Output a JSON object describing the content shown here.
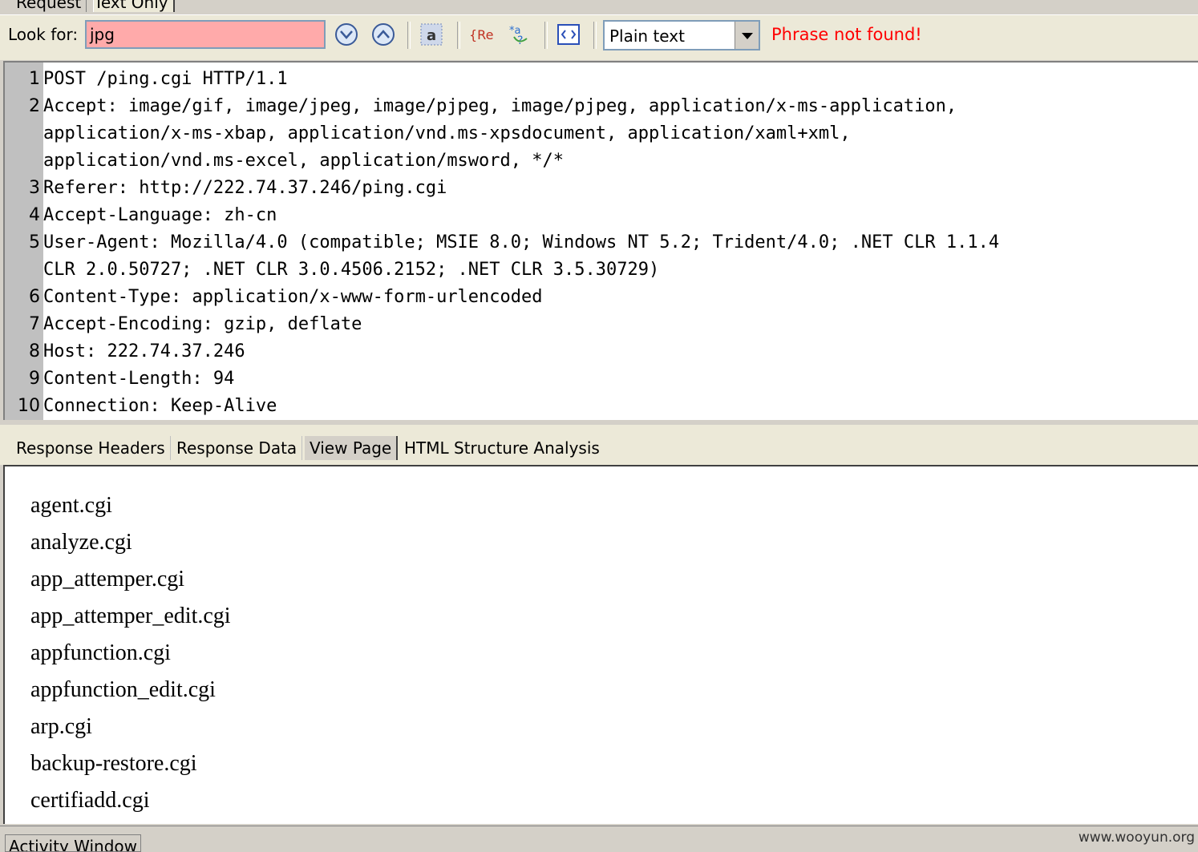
{
  "top_tabs": {
    "request": "Request",
    "text_only": "Text Only"
  },
  "toolbar": {
    "look_for_label": "Look for:",
    "search_value": "jpg",
    "mode_value": "Plain text",
    "status": "Phrase not found!"
  },
  "request": {
    "lines": [
      {
        "n": "1",
        "text": "POST /ping.cgi HTTP/1.1"
      },
      {
        "n": "2",
        "text": "Accept: image/gif, image/jpeg, image/pjpeg, image/pjpeg, application/x-ms-application,"
      },
      {
        "n": "",
        "text": "application/x-ms-xbap, application/vnd.ms-xpsdocument, application/xaml+xml,"
      },
      {
        "n": "",
        "text": "application/vnd.ms-excel, application/msword, */*"
      },
      {
        "n": "3",
        "text": "Referer: http://222.74.37.246/ping.cgi"
      },
      {
        "n": "4",
        "text": "Accept-Language: zh-cn"
      },
      {
        "n": "5",
        "text": "User-Agent: Mozilla/4.0 (compatible; MSIE 8.0; Windows NT 5.2; Trident/4.0; .NET CLR 1.1.4"
      },
      {
        "n": "",
        "text": "CLR 2.0.50727; .NET CLR 3.0.4506.2152; .NET CLR 3.5.30729)"
      },
      {
        "n": "6",
        "text": "Content-Type: application/x-www-form-urlencoded"
      },
      {
        "n": "7",
        "text": "Accept-Encoding: gzip, deflate"
      },
      {
        "n": "8",
        "text": "Host: 222.74.37.246"
      },
      {
        "n": "9",
        "text": "Content-Length: 94"
      },
      {
        "n": "10",
        "text": "Connection: Keep-Alive"
      }
    ]
  },
  "response_tabs": {
    "headers": "Response Headers",
    "data": "Response Data",
    "view": "View Page",
    "html": "HTML Structure Analysis"
  },
  "view_page": {
    "items": [
      "agent.cgi",
      "analyze.cgi",
      "app_attemper.cgi",
      "app_attemper_edit.cgi",
      "appfunction.cgi",
      "appfunction_edit.cgi",
      "arp.cgi",
      "backup-restore.cgi",
      "certifiadd.cgi"
    ]
  },
  "footer": {
    "activity": "Activity Window",
    "watermark": "www.wooyun.org"
  }
}
